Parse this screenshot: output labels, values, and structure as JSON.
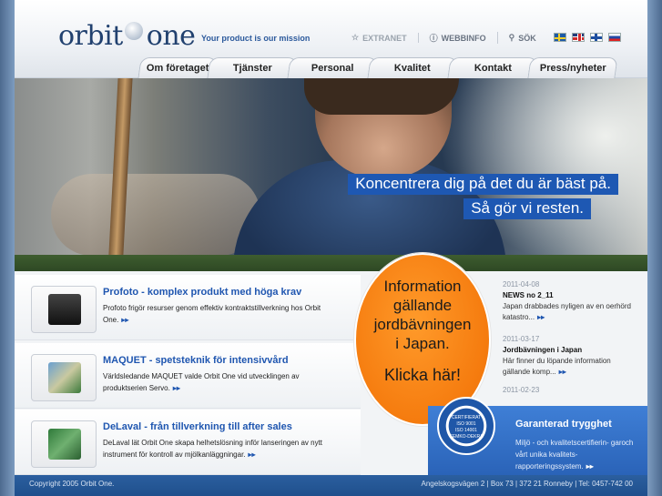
{
  "logo": {
    "text_orbit": "orbit",
    "text_one": "one"
  },
  "header": {
    "tagline": "Your product is our mission"
  },
  "toplinks": [
    {
      "label": "EXTRANET",
      "icon": "star-icon"
    },
    {
      "label": "WEBBINFO",
      "icon": "info-icon"
    },
    {
      "label": "SÖK",
      "icon": "search-icon"
    }
  ],
  "languages": [
    "sv",
    "en",
    "fi",
    "ru"
  ],
  "nav": {
    "tabs": [
      "Om företaget",
      "Tjänster",
      "Personal",
      "Kvalitet",
      "Kontakt",
      "Press/nyheter"
    ]
  },
  "hero": {
    "line1": "Koncentrera dig på det du är bäst på.",
    "line2": "Så gör vi resten."
  },
  "products": [
    {
      "title": "Profoto - komplex produkt med höga krav",
      "text": "Profoto frigör resurser genom effektiv kontraktstillverkning hos Orbit One."
    },
    {
      "title": "MAQUET - spetsteknik för intensivvård",
      "text": "Världsledande MAQUET valde Orbit One vid utvecklingen av produktserien Servo."
    },
    {
      "title": "DeLaval - från tillverkning till after sales",
      "text": "DeLaval lät Orbit One skapa helhetslösning inför lanseringen av nytt instrument för kontroll av mjölkanläggningar."
    }
  ],
  "more_arrow": "▸▸",
  "callout": {
    "lines": [
      "Information",
      "gällande",
      "jordbävningen",
      "i Japan."
    ],
    "click": "Klicka här!"
  },
  "news": [
    {
      "date": "2011-04-08",
      "title": "NEWS no 2_11",
      "text": "Japan drabbades nyligen av en oerhörd katastro..."
    },
    {
      "date": "2011-03-17",
      "title": "Jordbävningen i Japan",
      "text": "Här finner du löpande information gällande komp..."
    },
    {
      "date": "2011-02-23",
      "title": "",
      "text": ""
    }
  ],
  "guarantee": {
    "title": "Garanterad trygghet",
    "text": "Miljö - och kvalitetscertifierin- garoch vårt unika kvalitets- rapporteringssystem.",
    "seal_top": "CERTIFIERAT",
    "seal_mid1": "ISO 9001",
    "seal_mid2": "ISO 14001",
    "seal_bottom": "SEMKO-DEKRA"
  },
  "footer": {
    "copyright": "Copyright 2005 Orbit One.",
    "address": "Angelskogsvägen 2 | Box 73 | 372 21 Ronneby | Tel: 0457-742 00"
  },
  "colors": {
    "brand_blue": "#1f56b0",
    "orange": "#f57b0e",
    "footer": "#2b5f9f"
  }
}
